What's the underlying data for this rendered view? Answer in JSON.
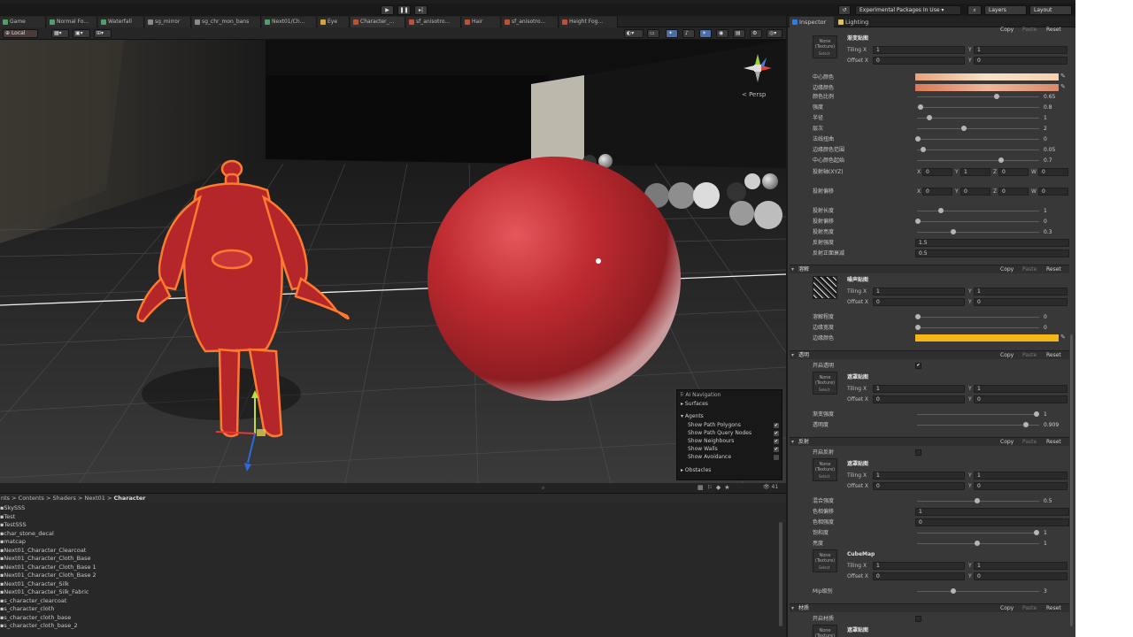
{
  "toolbar": {
    "packages": "Experimental Packages In Use ▾",
    "layers": "Layers",
    "layout": "Layout"
  },
  "scene_tabs": [
    "Game",
    "Normal Fo...",
    "Waterfall",
    "sg_mirror",
    "sg_chr_mon_bans",
    "Next01/Ch...",
    "Eye",
    "Character_...",
    "sf_anisotro...",
    "Hair",
    "sf_anisotro...",
    "Height Fog..."
  ],
  "scene_toolbar": {
    "pivot": "Local"
  },
  "viewport": {
    "persp_label": "< Persp"
  },
  "ai_nav": {
    "title": "AI Navigation",
    "surfaces": "Surfaces",
    "agents": "Agents",
    "items": [
      {
        "label": "Show Path Polygons",
        "checked": "✔"
      },
      {
        "label": "Show Path Query Nodes",
        "checked": "✔"
      },
      {
        "label": "Show Neighbours",
        "checked": "✔"
      },
      {
        "label": "Show Walls",
        "checked": "✔"
      },
      {
        "label": "Show Avoidance",
        "checked": ""
      }
    ],
    "obstacles": "Obstacles"
  },
  "project": {
    "breadcrumb": [
      "nts",
      "Contents",
      "Shaders",
      "Next01",
      "Character"
    ],
    "count": "41",
    "files": [
      "SkySSS",
      "Test",
      "TestSSS",
      "char_stone_decal",
      "matcap",
      "Next01_Character_Clearcoat",
      "Next01_Character_Cloth_Base",
      "Next01_Character_Cloth_Base 1",
      "Next01_Character_Cloth_Base 2",
      "Next01_Character_Silk",
      "Next01_Character_Silk_Fabric",
      "s_character_clearcoat",
      "s_character_cloth",
      "s_character_cloth_base",
      "s_character_cloth_base_2"
    ]
  },
  "inspector": {
    "tabs": [
      "Inspector",
      "Lighting"
    ],
    "copy": "Copy",
    "paste": "Paste",
    "reset": "Reset",
    "thumb_none": "None",
    "thumb_texture": "(Texture)",
    "thumb_select": "Select",
    "tiling": "Tiling X",
    "offset": "Offset X",
    "y": "Y",
    "z": "Z",
    "w": "W",
    "x": "X",
    "top_texture": "渐变贴图",
    "top_tiling": [
      "1",
      "1"
    ],
    "top_offset": [
      "0",
      "0"
    ],
    "color_rows": [
      "中心颜色",
      "边缘颜色"
    ],
    "slider_rows1": [
      {
        "label": "颜色比例",
        "value": "0.65"
      },
      {
        "label": "强度",
        "value": "0.8"
      },
      {
        "label": "半径",
        "value": "1"
      },
      {
        "label": "层次",
        "value": "2"
      },
      {
        "label": "法线扭曲",
        "value": "0"
      },
      {
        "label": "边缘颜色范围",
        "value": "0.05"
      },
      {
        "label": "中心颜色起始",
        "value": "0.7"
      }
    ],
    "vec_label": "投射轴(XYZ)",
    "vec_values": [
      "0",
      "1",
      "0",
      "0"
    ],
    "vec2_label": "投射偏移",
    "vec2_values": [
      "0",
      "0",
      "0",
      "0"
    ],
    "slider_rows2": [
      {
        "label": "投射长度",
        "value": "1"
      },
      {
        "label": "投射偏移",
        "value": "0"
      },
      {
        "label": "投射亮度",
        "value": "0.3"
      }
    ],
    "field_rows": [
      {
        "label": "反射强度",
        "value": "1.5"
      },
      {
        "label": "反射正面衰减",
        "value": "0.5"
      }
    ],
    "sec_dissolve": "溶解",
    "dissolve_tex": "噪声贴图",
    "dissolve_tiling": [
      "1",
      "1"
    ],
    "dissolve_offset": [
      "0",
      "0"
    ],
    "dissolve_rows": [
      {
        "label": "溶解程度",
        "value": "0"
      },
      {
        "label": "边缘宽度",
        "value": "0"
      }
    ],
    "dissolve_color": "边缘颜色",
    "sec_clip": "透明",
    "clip_toggle": "开启透明",
    "clip_tex": "遮罩贴图",
    "clip_tiling": [
      "1",
      "1"
    ],
    "clip_offset": [
      "0",
      "0"
    ],
    "clip_rows": [
      {
        "label": "渐变强度",
        "value": "1"
      },
      {
        "label": "透明度",
        "value": "0.909"
      }
    ],
    "sec_ref": "反射",
    "ref_toggle": "开启反射",
    "ref_tex": "遮罩贴图",
    "ref_tiling": [
      "1",
      "1"
    ],
    "ref_offset": [
      "0",
      "0"
    ],
    "ref_rows": [
      {
        "label": "混合强度",
        "value": "0.5",
        "type": "slider"
      },
      {
        "label": "色相偏移",
        "value": "1",
        "type": "field"
      },
      {
        "label": "色相强度",
        "value": "0",
        "type": "field"
      },
      {
        "label": "饱和度",
        "value": "1",
        "type": "slider"
      },
      {
        "label": "亮度",
        "value": "1",
        "type": "slider"
      }
    ],
    "cube_tex": "CubeMap",
    "cube_tiling": [
      "1",
      "1"
    ],
    "cube_offset": [
      "0",
      "0"
    ],
    "mip_label": "Mip级别",
    "mip_value": "3",
    "sec_mat": "材质",
    "mat_toggle": "开启材质",
    "mat_tex": "遮罩贴图"
  },
  "colors": {
    "center_gradient": "#f2c4a6",
    "edge_gradient": "#e8906a",
    "dissolve_edge": "#f5b717",
    "selection_outline": "#ff7a2e",
    "sphere_red": "#c7252b"
  }
}
